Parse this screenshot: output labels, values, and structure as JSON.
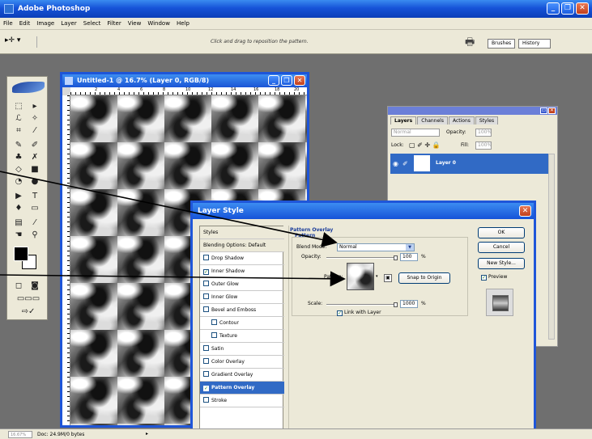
{
  "app": {
    "title": "Adobe Photoshop",
    "menu": [
      "File",
      "Edit",
      "Image",
      "Layer",
      "Select",
      "Filter",
      "View",
      "Window",
      "Help"
    ]
  },
  "options_bar": {
    "hint": "Click and drag to reposition the pattern.",
    "well_tabs": [
      "Brushes",
      "History"
    ]
  },
  "document": {
    "title": "Untitled-1 @ 16.7% (Layer 0, RGB/8)",
    "ruler_numbers": [
      "2",
      "4",
      "6",
      "8",
      "10",
      "12",
      "14",
      "16",
      "18",
      "20"
    ]
  },
  "status": {
    "zoom": "16.67%",
    "doc_info": "Doc: 24.9M/0 bytes"
  },
  "layers_panel": {
    "tabs": [
      "Layers",
      "Channels",
      "Actions",
      "Styles"
    ],
    "mode": "Normal",
    "opacity_label": "Opacity:",
    "opacity_value": "100%",
    "lock_label": "Lock:",
    "fill_label": "Fill:",
    "fill_value": "100%",
    "layer_name": "Layer 0"
  },
  "layer_style": {
    "title": "Layer Style",
    "styles_header": "Styles",
    "blending_options": "Blending Options: Default",
    "items": [
      {
        "label": "Drop Shadow",
        "checked": false,
        "sub": false
      },
      {
        "label": "Inner Shadow",
        "checked": true,
        "sub": false
      },
      {
        "label": "Outer Glow",
        "checked": false,
        "sub": false
      },
      {
        "label": "Inner Glow",
        "checked": false,
        "sub": false
      },
      {
        "label": "Bevel and Emboss",
        "checked": false,
        "sub": false
      },
      {
        "label": "Contour",
        "checked": false,
        "sub": true
      },
      {
        "label": "Texture",
        "checked": false,
        "sub": true
      },
      {
        "label": "Satin",
        "checked": false,
        "sub": false
      },
      {
        "label": "Color Overlay",
        "checked": false,
        "sub": false
      },
      {
        "label": "Gradient Overlay",
        "checked": false,
        "sub": false
      },
      {
        "label": "Pattern Overlay",
        "checked": true,
        "sub": false,
        "selected": true
      },
      {
        "label": "Stroke",
        "checked": false,
        "sub": false
      }
    ],
    "section_title": "Pattern Overlay",
    "group_title": "Pattern",
    "blend_mode_label": "Blend Mode:",
    "blend_mode_value": "Normal",
    "opacity_label": "Opacity:",
    "opacity_value": "100",
    "pattern_label": "Pattern:",
    "snap_button": "Snap to Origin",
    "scale_label": "Scale:",
    "scale_value": "1000",
    "percent": "%",
    "link_label": "Link with Layer",
    "ok": "OK",
    "cancel": "Cancel",
    "new_style": "New Style...",
    "preview": "Preview"
  }
}
